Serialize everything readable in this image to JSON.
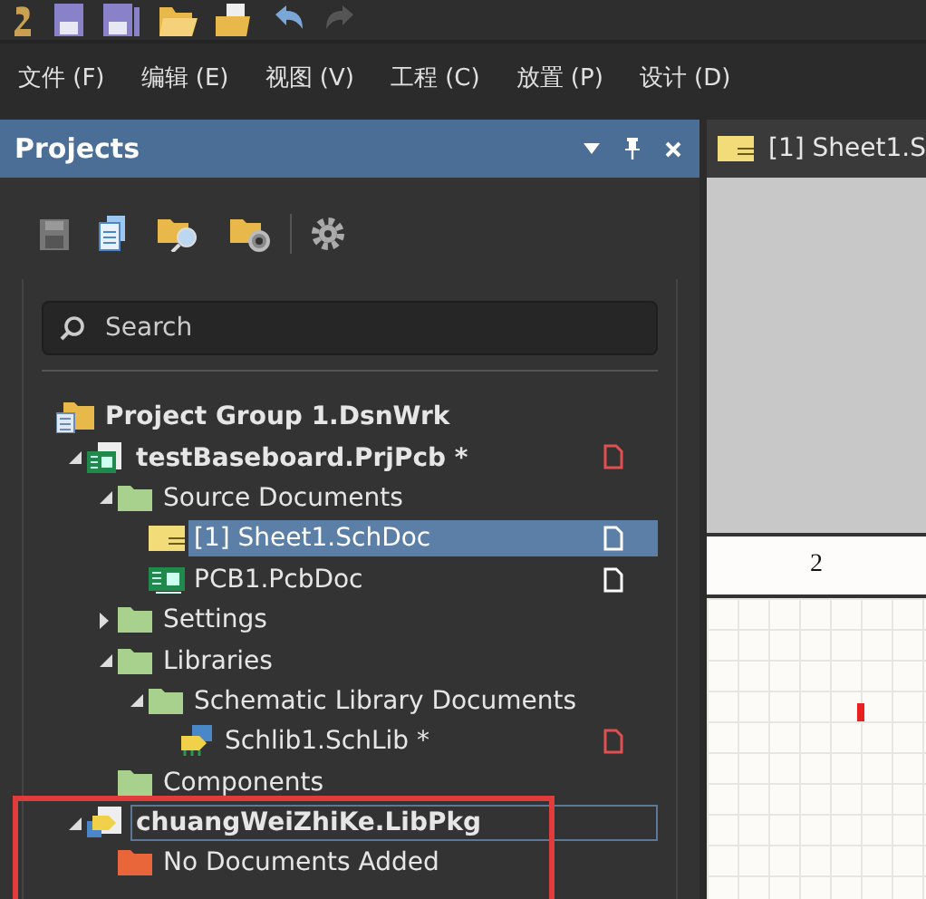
{
  "menu": [
    "文件 (F)",
    "编辑 (E)",
    "视图 (V)",
    "工程 (C)",
    "放置 (P)",
    "设计 (D)"
  ],
  "panel": {
    "title": "Projects",
    "search": {
      "placeholder": "Search"
    },
    "tree": [
      {
        "label": "Project Group 1.DsnWrk",
        "kind": "group",
        "selected": false,
        "children": [
          {
            "label": "testBaseboard.PrjPcb *",
            "kind": "pcb-project",
            "expanded": true,
            "selected": false,
            "modified": true,
            "children": [
              {
                "label": "Source Documents",
                "kind": "folder",
                "expanded": true,
                "selected": false,
                "children": [
                  {
                    "label": "[1] Sheet1.SchDoc",
                    "kind": "schdoc",
                    "selected": true,
                    "modified": false
                  },
                  {
                    "label": "PCB1.PcbDoc",
                    "kind": "pcbdoc",
                    "selected": false,
                    "modified": false
                  }
                ]
              },
              {
                "label": "Settings",
                "kind": "folder",
                "expanded": false,
                "selected": false
              },
              {
                "label": "Libraries",
                "kind": "folder",
                "expanded": true,
                "selected": false,
                "children": [
                  {
                    "label": "Schematic Library Documents",
                    "kind": "folder",
                    "expanded": true,
                    "selected": false,
                    "children": [
                      {
                        "label": "Schlib1.SchLib *",
                        "kind": "schlib",
                        "selected": false,
                        "modified": true
                      }
                    ]
                  }
                ]
              },
              {
                "label": "Components",
                "kind": "folder",
                "selected": false
              }
            ]
          },
          {
            "label": "chuangWeiZhiKe.LibPkg",
            "kind": "libpkg",
            "expanded": true,
            "selected": false,
            "focused": true,
            "children": [
              {
                "label": "No Documents Added",
                "kind": "empty-folder",
                "selected": false
              }
            ]
          }
        ]
      }
    ]
  },
  "document_tab": {
    "label": "[1] Sheet1.S"
  },
  "sheet": {
    "zone_label": "2"
  }
}
